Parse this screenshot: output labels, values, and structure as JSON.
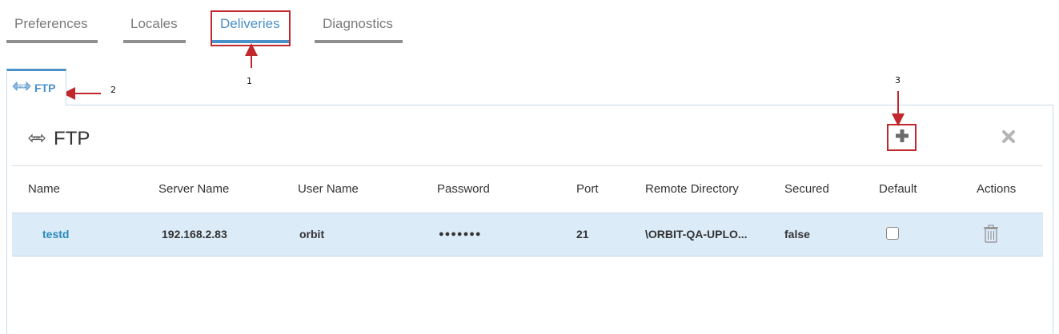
{
  "tabs": [
    {
      "label": "Preferences",
      "active": false
    },
    {
      "label": "Locales",
      "active": false
    },
    {
      "label": "Deliveries",
      "active": true
    },
    {
      "label": "Diagnostics",
      "active": false
    }
  ],
  "subtab": {
    "label": "FTP",
    "icon": "ftp-transfer-icon"
  },
  "panel": {
    "title": "FTP",
    "title_icon": "ftp-transfer-icon",
    "add_icon": "plus-icon",
    "close_icon": "close-icon"
  },
  "table": {
    "columns": [
      "Name",
      "Server Name",
      "User Name",
      "Password",
      "Port",
      "Remote Directory",
      "Secured",
      "Default",
      "Actions"
    ],
    "rows": [
      {
        "name": "testd",
        "server_name": "192.168.2.83",
        "user_name": "orbit",
        "password": "●●●●●●●",
        "port": "21",
        "remote_directory": "\\ORBIT-QA-UPLO...",
        "secured": "false",
        "default": false,
        "action_icon": "trash-icon"
      }
    ]
  },
  "annotations": {
    "n1": "1",
    "n2": "2",
    "n3": "3",
    "color": "#c0282d"
  },
  "colors": {
    "accent": "#4a90c9",
    "row_highlight": "#dcebf8",
    "link": "#2a88b8"
  }
}
